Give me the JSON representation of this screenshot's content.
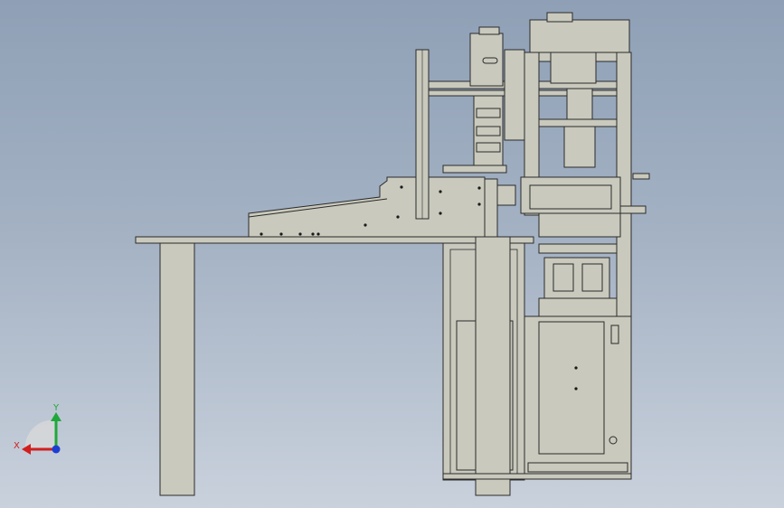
{
  "viewport": {
    "background_top": "#8fa0b6",
    "background_bottom": "#c9d1dc"
  },
  "model": {
    "part_fill": "#c9c9bd",
    "edge_color": "#2b2b2b",
    "hole_color": "#1a1a1a"
  },
  "triad": {
    "x_label": "X",
    "y_label": "Y",
    "x_color": "#d11f1f",
    "y_color": "#1fa83a",
    "z_color": "#1c3fd1"
  }
}
